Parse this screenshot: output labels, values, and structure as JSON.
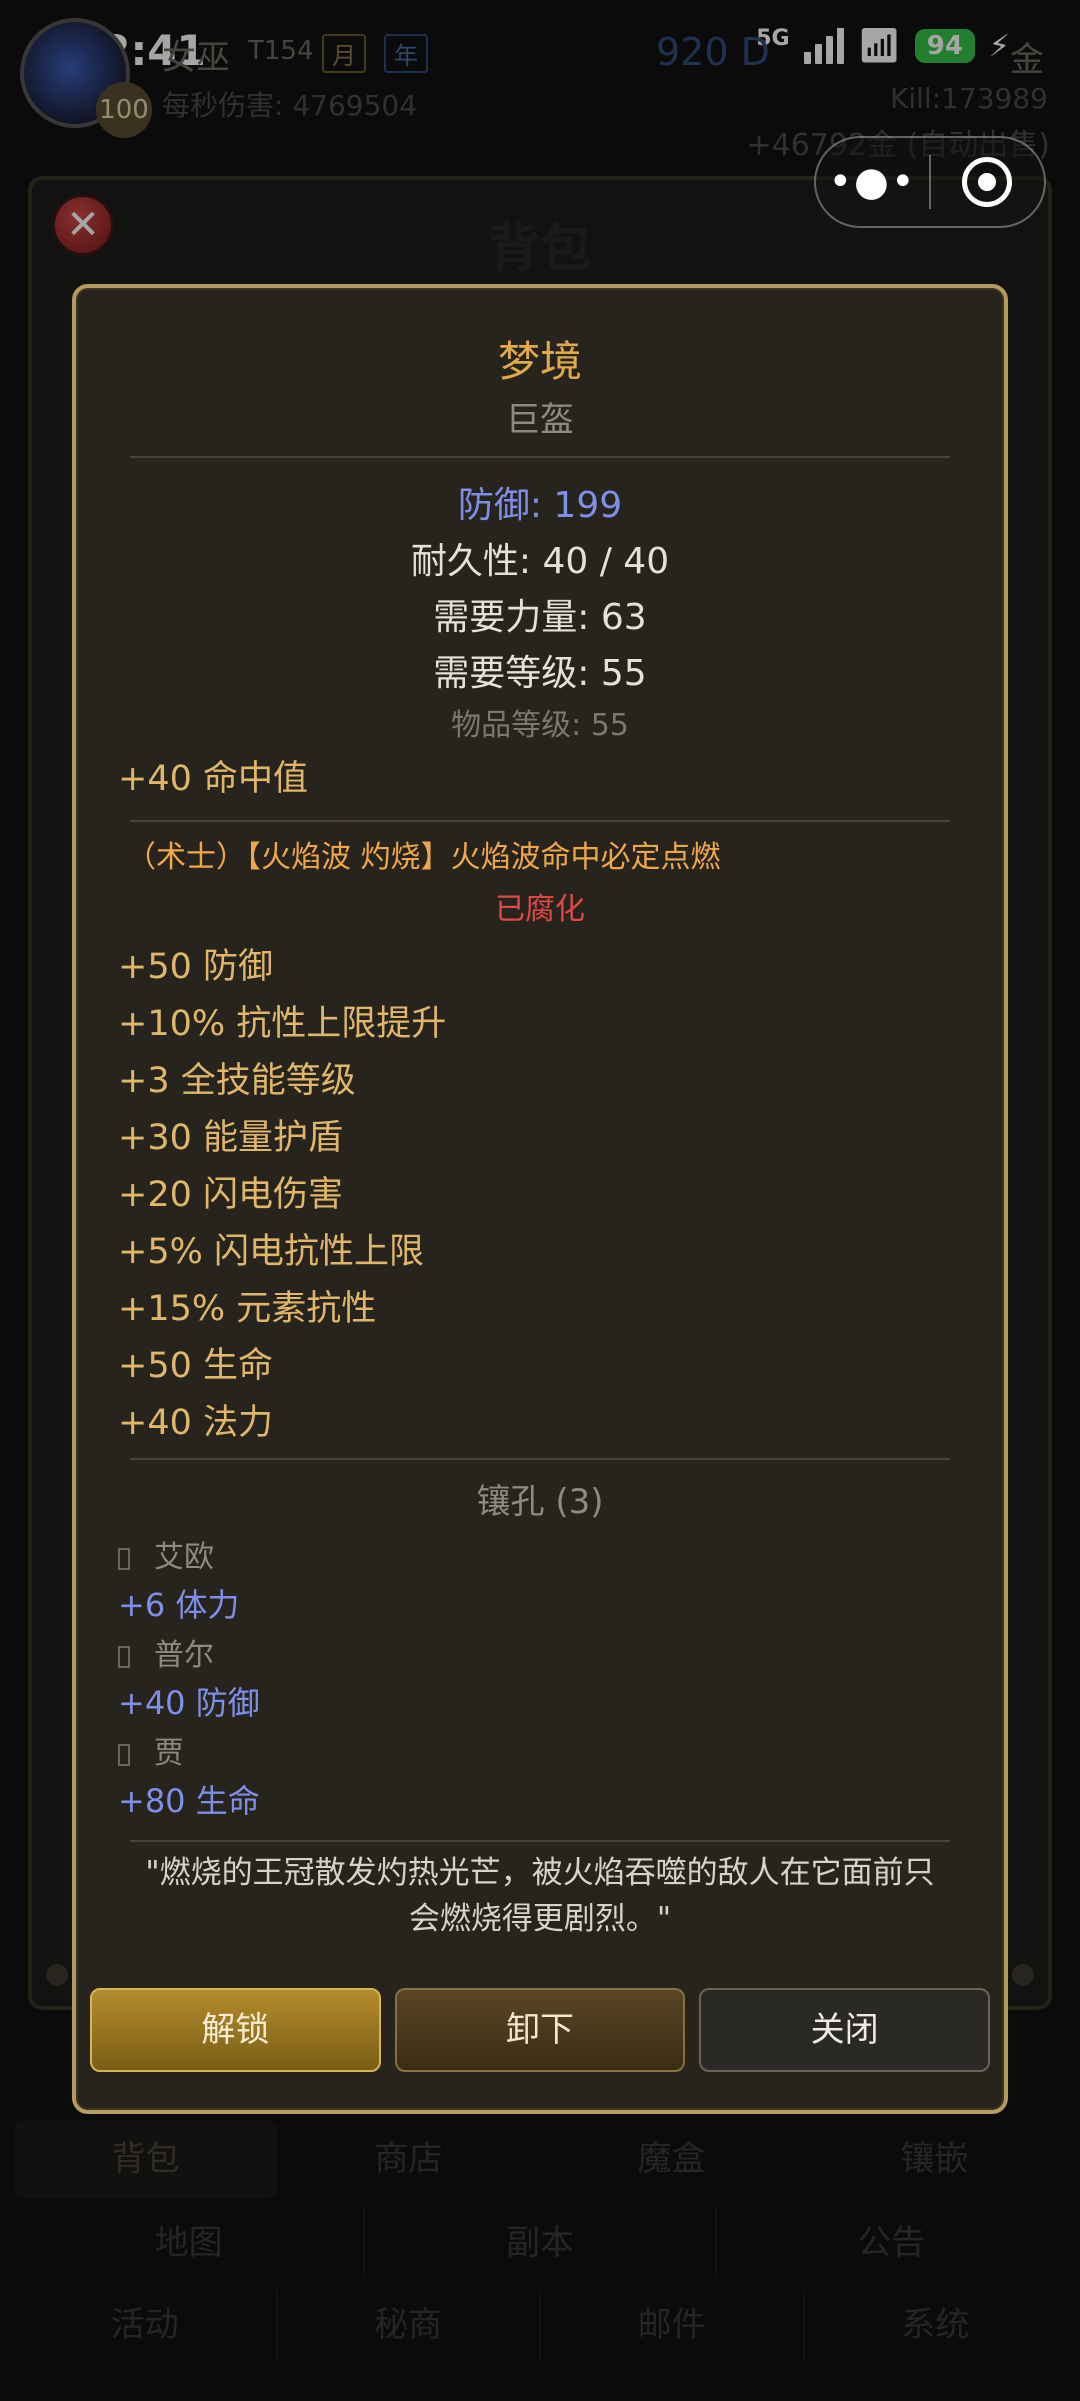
{
  "status_bar": {
    "time": "12:41",
    "network": "5G",
    "battery": "94"
  },
  "hud": {
    "level": "100",
    "char_name": "女巫",
    "tier": "T154",
    "tag_month": "月",
    "tag_year": "年",
    "dps": "每秒伤害: 4769504",
    "wave": "920 D",
    "gold_label": "金",
    "kill": "Kill:173989",
    "income": "+46792金 (自动出售)"
  },
  "capsule": {
    "more_icon": "more-dots-icon",
    "target_icon": "target-icon"
  },
  "bag": {
    "title": "背包"
  },
  "item": {
    "name": "梦境",
    "type": "巨盔",
    "defense": "防御: 199",
    "durability": "耐久性: 40 / 40",
    "req_str": "需要力量: 63",
    "req_level": "需要等级: 55",
    "item_level": "物品等级: 55",
    "implicit": "+40 命中值",
    "set_bonus": "（术士）【火焰波 灼烧】火焰波命中必定点燃",
    "corrupted": "已腐化",
    "affixes": [
      "+50 防御",
      "+10% 抗性上限提升",
      "+3 全技能等级",
      "+30 能量护盾",
      "+20 闪电伤害",
      "+5% 闪电抗性上限",
      "+15% 元素抗性",
      "+50 生命",
      "+40 法力"
    ],
    "socket_title": "镶孔 (3)",
    "sockets": [
      {
        "name": "艾欧",
        "bonus": "+6 体力"
      },
      {
        "name": "普尔",
        "bonus": "+40 防御"
      },
      {
        "name": "贾",
        "bonus": "+80 生命"
      }
    ],
    "flavor_line1": "\"燃烧的王冠散发灼热光芒，被火焰吞噬的敌人在它面前只",
    "flavor_line2": "会燃烧得更剧烈。\""
  },
  "buttons": {
    "unlock": "解锁",
    "unequip": "卸下",
    "close": "关闭"
  },
  "nav": {
    "row1": [
      "背包",
      "商店",
      "魔盒",
      "镶嵌"
    ],
    "row2": [
      "地图",
      "副本",
      "公告"
    ],
    "row3": [
      "活动",
      "秘商",
      "邮件",
      "系统"
    ]
  },
  "colors": {
    "item_name": "#e0a94c",
    "defense_blue": "#7f8fe8",
    "corrupted_red": "#e04848",
    "modal_border": "#b59b62"
  }
}
